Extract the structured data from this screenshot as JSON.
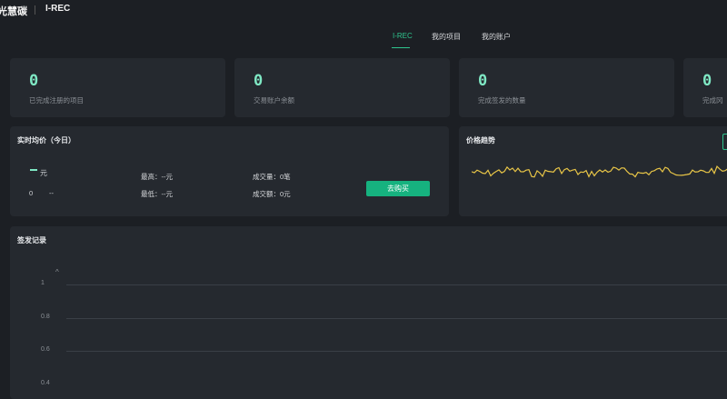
{
  "header": {
    "brand": "光慧碳",
    "product": "I-REC"
  },
  "nav": {
    "tabs": [
      {
        "label": "I-REC",
        "active": true
      },
      {
        "label": "我的项目",
        "active": false
      },
      {
        "label": "我的账户",
        "active": false
      }
    ]
  },
  "stats": [
    {
      "value": "0",
      "label": "已完成注册的项目"
    },
    {
      "value": "0",
      "label": "交易账户余额"
    },
    {
      "value": "0",
      "label": "完成签发的数量"
    },
    {
      "value": "0",
      "label": "完成冈"
    }
  ],
  "realtime": {
    "title": "实时均价（今日）",
    "unit": "元",
    "zero": "0",
    "change": "--",
    "high": "最高：--元",
    "low": "最低：--元",
    "volume": "成交量：0笔",
    "amount": "成交额：0元",
    "buy_label": "去购买"
  },
  "trend": {
    "title": "价格趋势",
    "line_color": "#e8c547"
  },
  "issuance": {
    "title": "签发记录",
    "y_ticks": [
      "1",
      "0.8",
      "0.6",
      "0.4"
    ]
  },
  "colors": {
    "accent": "#2fc58e",
    "background": "#1c1f24",
    "card": "#25292f"
  }
}
